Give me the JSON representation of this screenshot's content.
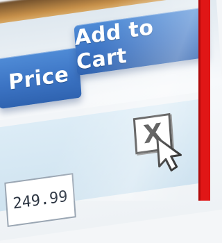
{
  "cart_table": {
    "headers": {
      "price": "Price",
      "add_to_cart": "Add to Cart"
    },
    "row": {
      "price_value": "249.99",
      "checkbox_mark": "X"
    }
  },
  "icons": {
    "cursor": "mouse-pointer-icon"
  },
  "colors": {
    "header_blue": "#3c74c4",
    "cell_blue": "#d6e8f3",
    "frame_red": "#e01616"
  }
}
